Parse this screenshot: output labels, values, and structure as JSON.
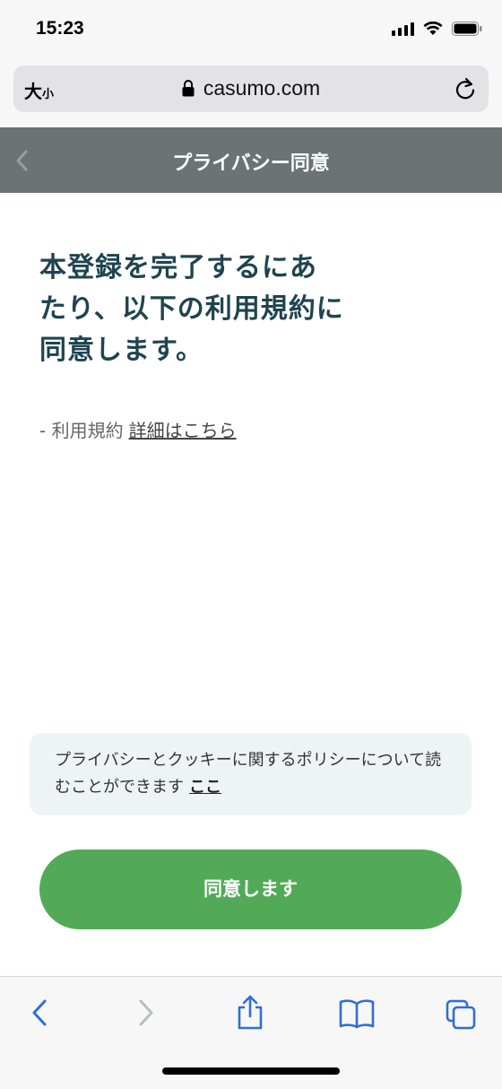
{
  "status_bar": {
    "time": "15:23"
  },
  "browser": {
    "text_size_large": "大",
    "text_size_small": "小",
    "url": "casumo.com"
  },
  "header": {
    "title": "プライバシー同意"
  },
  "main": {
    "title": "本登録を完了するにあたり、以下の利用規約に同意します。",
    "terms_prefix": "- 利用規約",
    "terms_link": "詳細はこちら"
  },
  "notice": {
    "text": "プライバシーとクッキーに関するポリシーについて読むことができます",
    "link": "ここ"
  },
  "agree_button": {
    "label": "同意します"
  },
  "colors": {
    "header_bg": "#6b7374",
    "title_text": "#1f4450",
    "notice_bg": "#eef4f5",
    "button_bg": "#52aa58",
    "toolbar_icon": "#2f6fd6"
  }
}
